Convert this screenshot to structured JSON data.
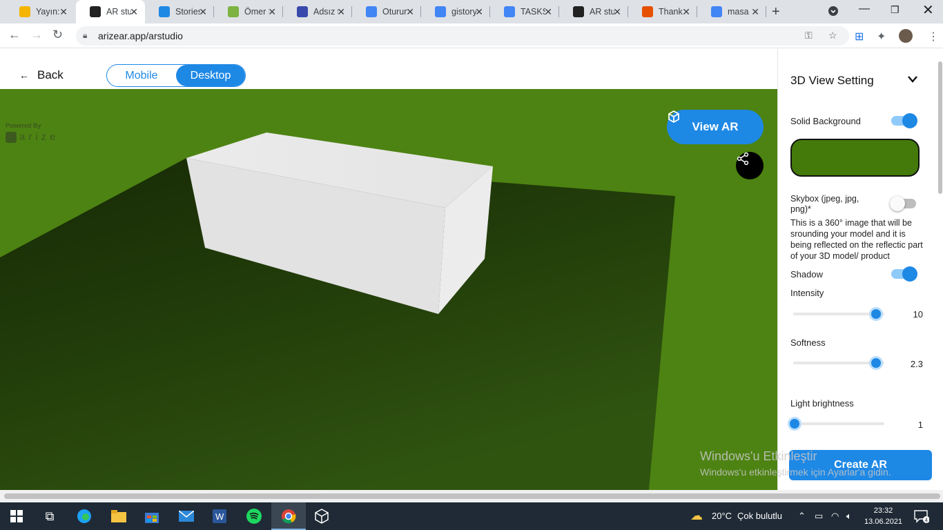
{
  "browser": {
    "tabs": [
      {
        "label": "Yayın: I",
        "color": "#f4b400"
      },
      {
        "label": "AR stu",
        "color": "#222222"
      },
      {
        "label": "Stories",
        "color": "#1e88e5"
      },
      {
        "label": "Ömer I",
        "color": "#7cb342"
      },
      {
        "label": "Adsız t",
        "color": "#3949ab"
      },
      {
        "label": "Oturun",
        "color": "#4285f4"
      },
      {
        "label": "gistory",
        "color": "#4285f4"
      },
      {
        "label": "TASKS",
        "color": "#4285f4"
      },
      {
        "label": "AR stu",
        "color": "#222222"
      },
      {
        "label": "Thank",
        "color": "#e65100"
      },
      {
        "label": "masa",
        "color": "#4285f4"
      }
    ],
    "url": "arizear.app/arstudio"
  },
  "header": {
    "back_label": "Back",
    "mode_mobile": "Mobile",
    "mode_desktop": "Desktop",
    "active_mode": "Desktop"
  },
  "viewport": {
    "powered_by": "Powered By",
    "brand": "arize",
    "view_ar_label": "View AR",
    "background_color": "#4d8312"
  },
  "panel": {
    "title": "3D View Setting",
    "solid_background_label": "Solid Background",
    "solid_background_on": true,
    "solid_background_color": "#437a0a",
    "skybox_label": "Skybox (jpeg, jpg, png)*",
    "skybox_on": false,
    "skybox_description": "This is a 360° image that will be srounding your model and it is being reflected on the reflectic part of your 3D model/ product",
    "shadow_label": "Shadow",
    "shadow_on": true,
    "intensity_label": "Intensity",
    "intensity_value": "10",
    "softness_label": "Softness",
    "softness_value": "2.3",
    "light_brightness_label": "Light brightness",
    "light_brightness_value": "1",
    "create_ar_label": "Create AR"
  },
  "watermark": {
    "line1": "Windows'u Etkinleştir",
    "line2": "Windows'u etkinleştirmek için Ayarlar'a gidin."
  },
  "taskbar": {
    "temperature": "20°C",
    "weather": "Çok bulutlu",
    "time": "23:32",
    "date": "13.06.2021",
    "notifications": "4"
  }
}
